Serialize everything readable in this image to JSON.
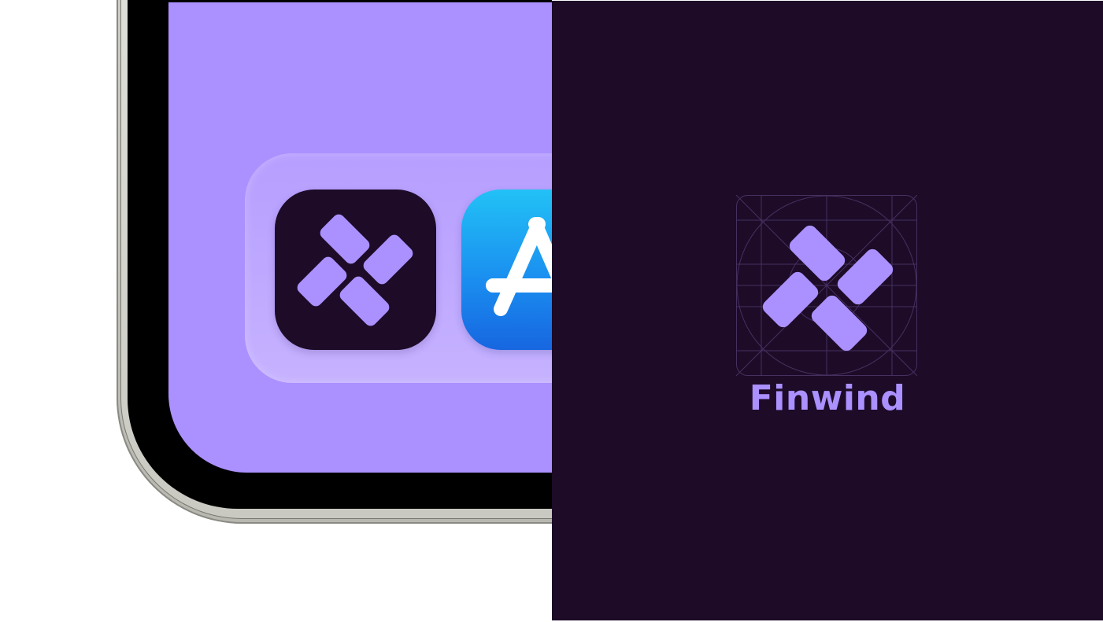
{
  "colors": {
    "brand_purple": "#ab90ff",
    "brand_dark": "#1d0b28",
    "phone_frame": "#000000",
    "app_store_blue": "#1a8ff0"
  },
  "phone": {
    "dock_apps": [
      {
        "name": "finwind",
        "icon": "finwind-logo-icon"
      },
      {
        "name": "app-store",
        "icon": "app-store-icon"
      }
    ]
  },
  "brand": {
    "name": "Finwind",
    "logo_icon": "finwind-logo-icon",
    "construction_grid": "icon-grid-guides"
  }
}
